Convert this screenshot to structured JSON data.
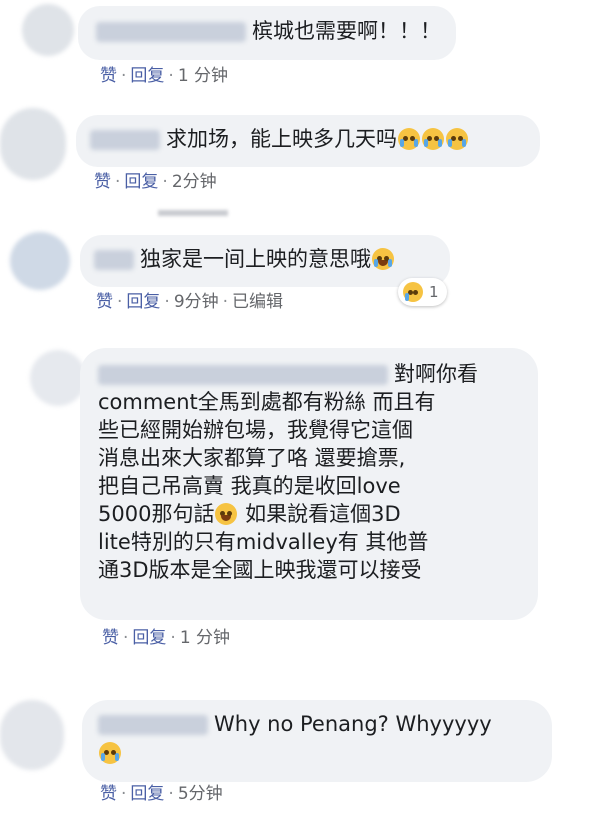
{
  "comments": [
    {
      "text": "槟城也需要啊！！！",
      "actions": {
        "like": "赞",
        "reply": "回复",
        "time": "1 分钟"
      }
    },
    {
      "text": "求加场，能上映多几天吗",
      "emojis": [
        "loudly-crying-face",
        "loudly-crying-face",
        "loudly-crying-face"
      ],
      "actions": {
        "like": "赞",
        "reply": "回复",
        "time": "2分钟"
      }
    },
    {
      "text": "独家是一间上映的意思哦",
      "emojis": [
        "face-with-tears-of-joy"
      ],
      "actions": {
        "like": "赞",
        "reply": "回复",
        "time": "9分钟",
        "edited": "已编辑"
      },
      "reaction": {
        "emoji": "crying-face",
        "count": "1"
      }
    },
    {
      "lines": [
        "對啊你看",
        "comment全馬到處都有粉絲 而且有",
        "些已經開始辦包場，我覺得它這個",
        "消息出來大家都算了咯 還要搶票,",
        "把自己吊高賣 我真的是收回love",
        "5000那句話",
        "如果說看這個3D",
        "lite特別的只有midvalley有 其他普",
        "通3D版本是全國上映我還可以接受"
      ],
      "emojis": [
        "grinning-face-with-sweat"
      ],
      "actions": {
        "like": "赞",
        "reply": "回复",
        "time": "1 分钟"
      }
    },
    {
      "text": "Why no Penang? Whyyyyy",
      "emojis": [
        "crying-face"
      ],
      "actions": {
        "like": "赞",
        "reply": "回复",
        "time": "5分钟"
      }
    }
  ],
  "colors": {
    "bubble": "#f0f2f5",
    "action_link": "#4a5fa5",
    "meta": "#65676b",
    "emoji_yellow": "#f6c342"
  }
}
